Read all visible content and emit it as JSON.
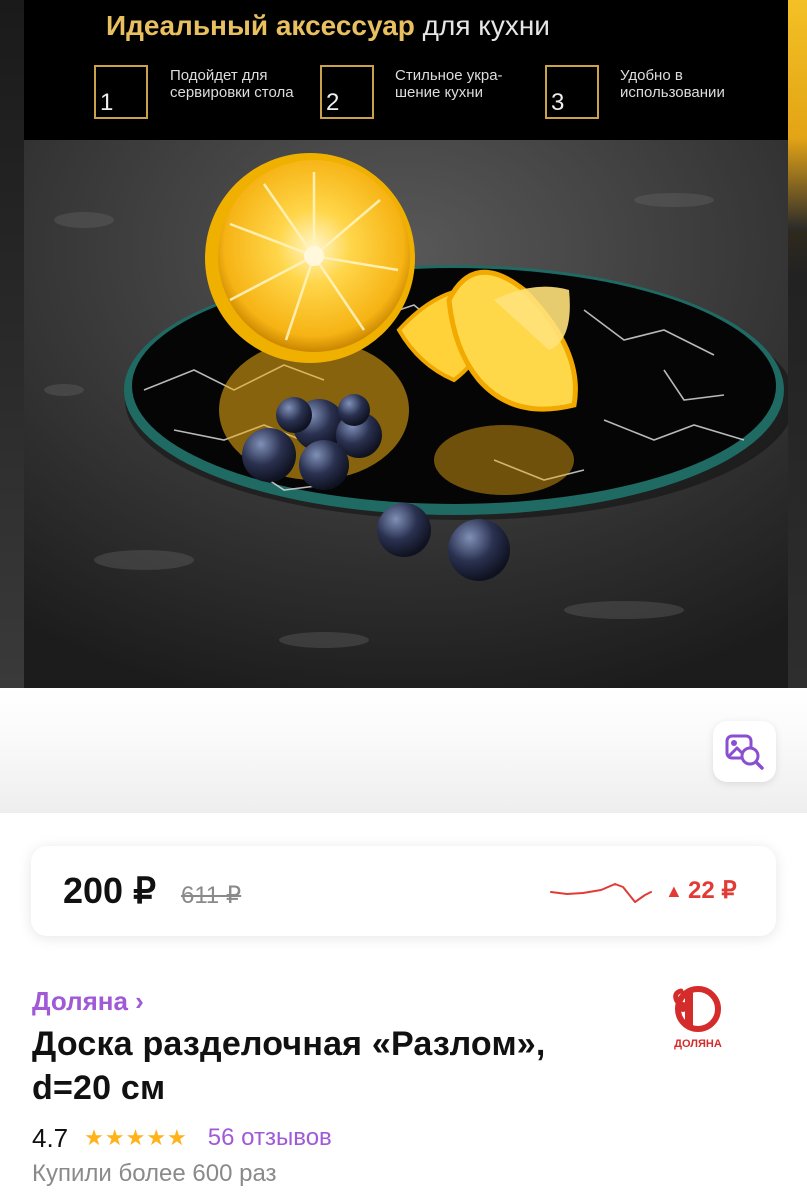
{
  "banner": {
    "headline_bold": "Идеальный аксессуар",
    "headline_rest": "для кухни",
    "features": [
      {
        "num": "1",
        "text": "Подойдет для сервировки стола"
      },
      {
        "num": "2",
        "text": "Стильное укра-шение кухни"
      },
      {
        "num": "3",
        "text": "Удобно в использовании"
      }
    ]
  },
  "image_search_icon": "image-search-icon",
  "price": {
    "current": "200 ₽",
    "old": "611 ₽",
    "change": "22 ₽",
    "change_direction": "up",
    "change_color": "#e23b36"
  },
  "brand": {
    "link_label": "Доляна ›",
    "logo_text": "ДОЛЯНА"
  },
  "product": {
    "title": "Доска разделочная «Разлом», d=20 см",
    "rating": "4.7",
    "stars": "★★★★★",
    "stars_filled": 5,
    "reviews": "56 отзывов",
    "bought": "Купили более 600 раз"
  },
  "colors": {
    "accent": "#a05ad8",
    "star": "#ffb21a",
    "price_up": "#e23b36",
    "banner_gold": "#e8c060"
  }
}
